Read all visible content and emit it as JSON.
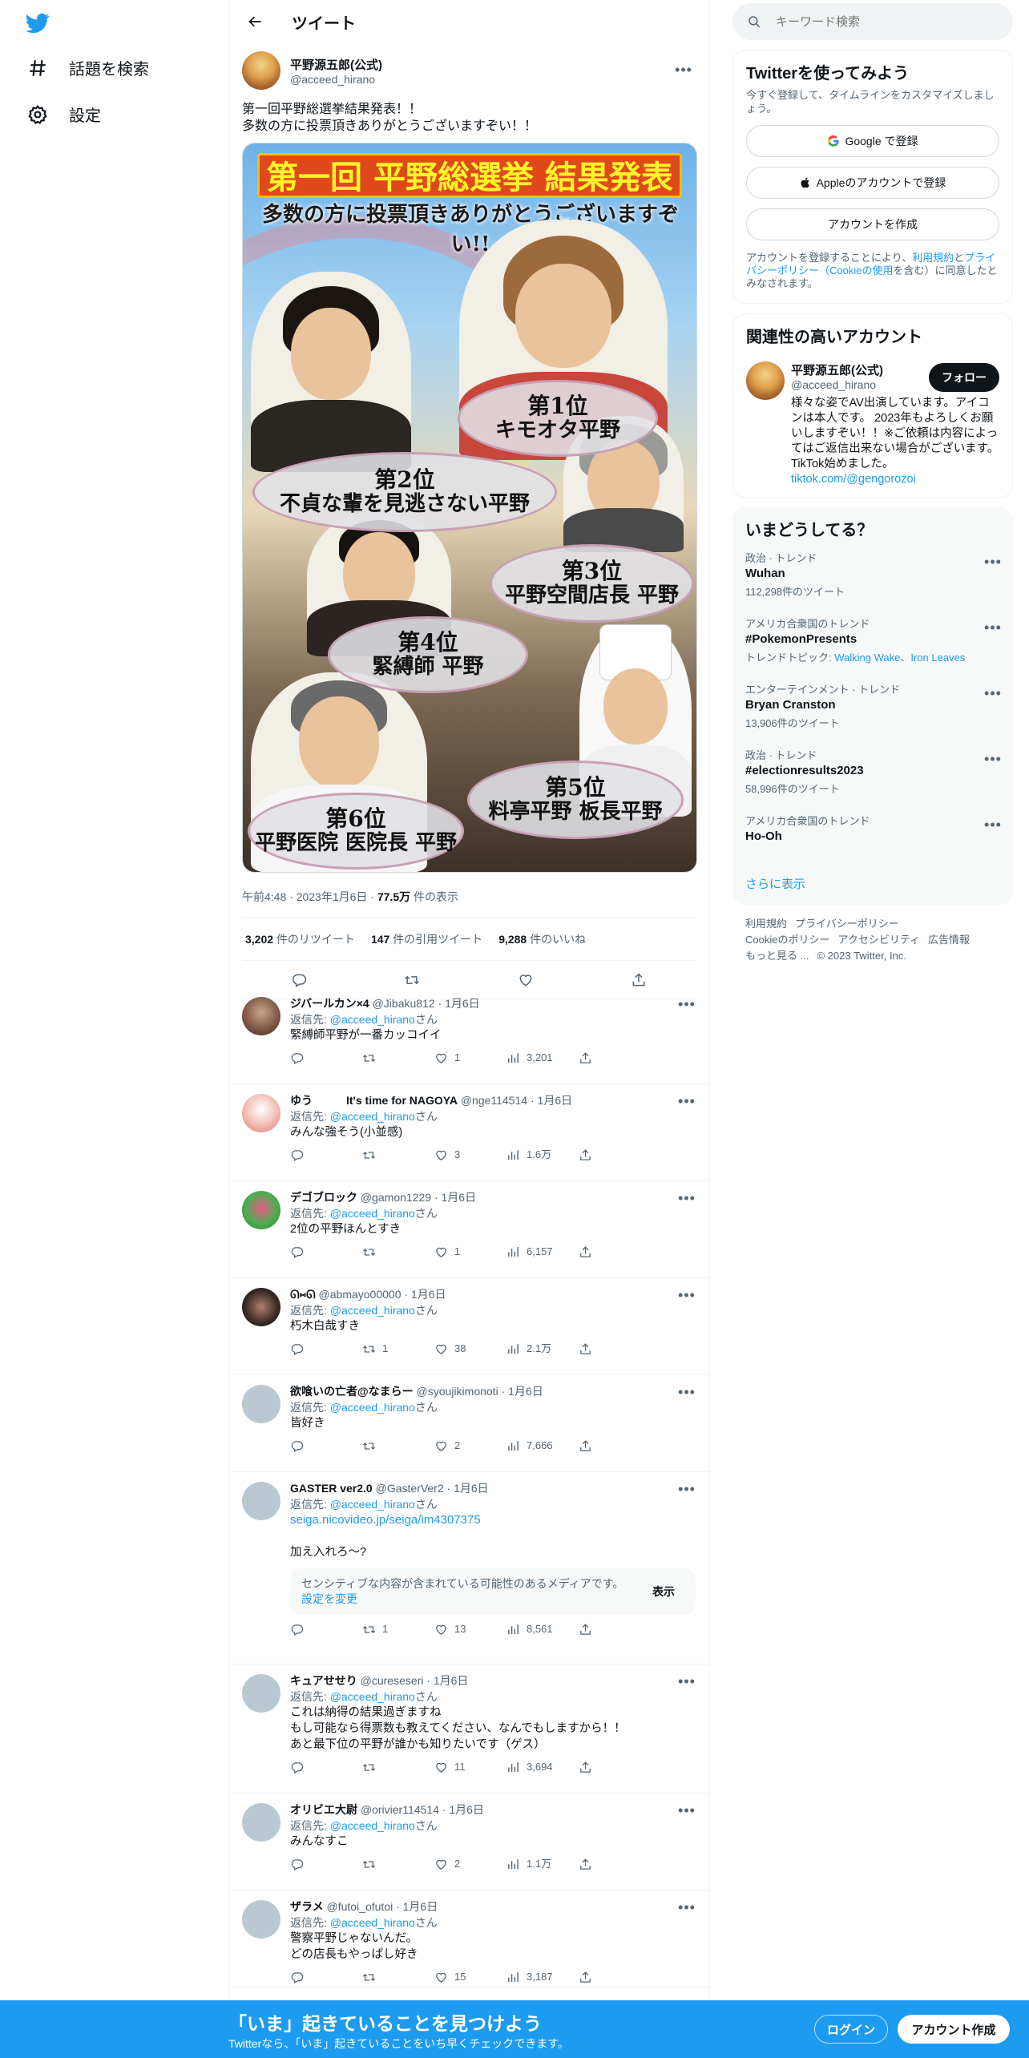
{
  "nav": {
    "explore_label": "話題を検索",
    "settings_label": "設定"
  },
  "header": {
    "title": "ツイート"
  },
  "tweet": {
    "author_name": "平野源五郎(公式)",
    "author_handle": "@acceed_hirano",
    "text": "第一回平野総選挙結果発表！！\n多数の方に投票頂きありがとうございますぞい！！",
    "poster": {
      "title": "第一回 平野総選挙 結果発表",
      "subtitle": "多数の方に投票頂きありがとうございますぞい!!",
      "ranks": [
        {
          "rank": "第1位",
          "name": "キモオタ平野"
        },
        {
          "rank": "第2位",
          "name": "不貞な輩を見逃さない平野"
        },
        {
          "rank": "第3位",
          "name": "平野空間店長 平野"
        },
        {
          "rank": "第4位",
          "name": "緊縛師 平野"
        },
        {
          "rank": "第5位",
          "name": "料亭平野 板長平野"
        },
        {
          "rank": "第6位",
          "name": "平野医院 医院長 平野"
        }
      ]
    },
    "timestamp": "午前4:48 · 2023年1月6日 · ",
    "views": "77.5万",
    "views_suffix": " 件の表示",
    "retweets": "3,202",
    "retweets_label": " 件のリツイート",
    "quotes": "147",
    "quotes_label": " 件の引用ツイート",
    "likes": "9,288",
    "likes_label": " 件のいいね"
  },
  "reply_prefix": "返信先: ",
  "reply_suffix": "さん",
  "reply_target": "@acceed_hirano",
  "replies": [
    {
      "name": "ジバールカン×4",
      "handle": "@Jibaku812",
      "date": " · 1月6日",
      "text": "緊縛師平野が一番カッコイイ",
      "replies": "",
      "retweets": "",
      "likes": "1",
      "views": "3,201"
    },
    {
      "name": "ゆう　　　It's time for NAGOYA",
      "handle": "@nge114514",
      "date": " · 1月6日",
      "text": "みんな強そう(小並感)",
      "replies": "",
      "retweets": "",
      "likes": "3",
      "views": "1.6万"
    },
    {
      "name": "デゴブロック",
      "handle": "@gamon1229",
      "date": " · 1月6日",
      "text": "2位の平野ほんとすき",
      "replies": "",
      "retweets": "",
      "likes": "1",
      "views": "6,157"
    },
    {
      "name": "ᘏ⑅ᘏ",
      "handle": "@abmayo00000",
      "date": " · 1月6日",
      "text": "朽木白哉すき",
      "replies": "",
      "retweets": "1",
      "likes": "38",
      "views": "2.1万"
    },
    {
      "name": "欲喰いの亡者@なまらー",
      "handle": "@syoujikimonoti",
      "date": " · 1月6日",
      "text": "皆好き",
      "replies": "",
      "retweets": "",
      "likes": "2",
      "views": "7,666"
    },
    {
      "name": "GASTER ver2.0",
      "handle": "@GasterVer2",
      "date": " · 1月6日",
      "link": "seiga.nicovideo.jp/seiga/im4307375",
      "text": "加え入れろ〜?",
      "sensitive_text": "センシティブな内容が含まれている可能性のあるメディアです。",
      "sensitive_link": "設定を変更",
      "sensitive_button": "表示",
      "replies": "",
      "retweets": "1",
      "likes": "13",
      "views": "8,561"
    },
    {
      "name": "キュアせせり",
      "handle": "@cureseseri",
      "date": " · 1月6日",
      "text": "これは納得の結果過ぎますね\nもし可能なら得票数も教えてください、なんでもしますから！！\nあと最下位の平野が誰かも知りたいです（ゲス）",
      "replies": "",
      "retweets": "",
      "likes": "11",
      "views": "3,694"
    },
    {
      "name": "オリビエ大尉",
      "handle": "@orivier114514",
      "date": " · 1月6日",
      "text": "みんなすこ",
      "replies": "",
      "retweets": "",
      "likes": "2",
      "views": "1.1万"
    },
    {
      "name": "ザラメ",
      "handle": "@futoi_ofutoi",
      "date": " · 1月6日",
      "text": "警察平野じゃないんだ。\nどの店長もやっぱし好き",
      "replies": "",
      "retweets": "",
      "likes": "15",
      "views": "3,187"
    }
  ],
  "search": {
    "placeholder": "キーワード検索"
  },
  "signup_card": {
    "title": "Twitterを使ってみよう",
    "desc": "今すぐ登録して、タイムラインをカスタマイズしましょう。",
    "google_label": "Google で登録",
    "apple_label": "Appleのアカウントで登録",
    "create_label": "アカウントを作成",
    "legal_prefix": "アカウントを登録することにより、",
    "legal_terms": "利用規約",
    "legal_and": "と",
    "legal_privacy": "プライバシーポリシー",
    "legal_open": "（",
    "legal_cookie": "Cookieの使用",
    "legal_suffix": "を含む）に同意したとみなされます。"
  },
  "related": {
    "title": "関連性の高いアカウント",
    "name": "平野源五郎(公式)",
    "handle": "@acceed_hirano",
    "follow_label": "フォロー",
    "bio": "様々な姿でAV出演しています。アイコンは本人です。 2023年もよろしくお願いしますぞい！！※ご依頼は内容によってはご返信出来ない場合がございます。 TikTok始めました。",
    "bio_link": "tiktok.com/@gengorozoi"
  },
  "trends": {
    "title": "いまどうしてる？",
    "items": [
      {
        "category": "政治 · トレンド",
        "name": "Wuhan",
        "count": "112,298件のツイート"
      },
      {
        "category": "アメリカ合衆国のトレンド",
        "name": "#PokemonPresents",
        "topic_prefix": "トレンドトピック: ",
        "topic_links": "Walking Wake、Iron Leaves"
      },
      {
        "category": "エンターテインメント · トレンド",
        "name": "Bryan Cranston",
        "count": "13,906件のツイート"
      },
      {
        "category": "政治 · トレンド",
        "name": "#electionresults2023",
        "count": "58,996件のツイート"
      },
      {
        "category": "アメリカ合衆国のトレンド",
        "name": "Ho-Oh",
        "count": ""
      }
    ],
    "show_more": "さらに表示"
  },
  "footer": {
    "terms": "利用規約",
    "privacy": "プライバシーポリシー",
    "cookie": "Cookieのポリシー",
    "accessibility": "アクセシビリティ",
    "ads": "広告情報",
    "more": "もっと見る ...",
    "copyright": "© 2023 Twitter, Inc."
  },
  "banner": {
    "title": "「いま」起きていることを見つけよう",
    "subtitle": "Twitterなら、「いま」起きていることをいち早くチェックできます。",
    "login": "ログイン",
    "signup": "アカウント作成"
  },
  "colors": {
    "accent": "#1d9bf0",
    "text": "#0f1419",
    "muted": "#536471"
  }
}
